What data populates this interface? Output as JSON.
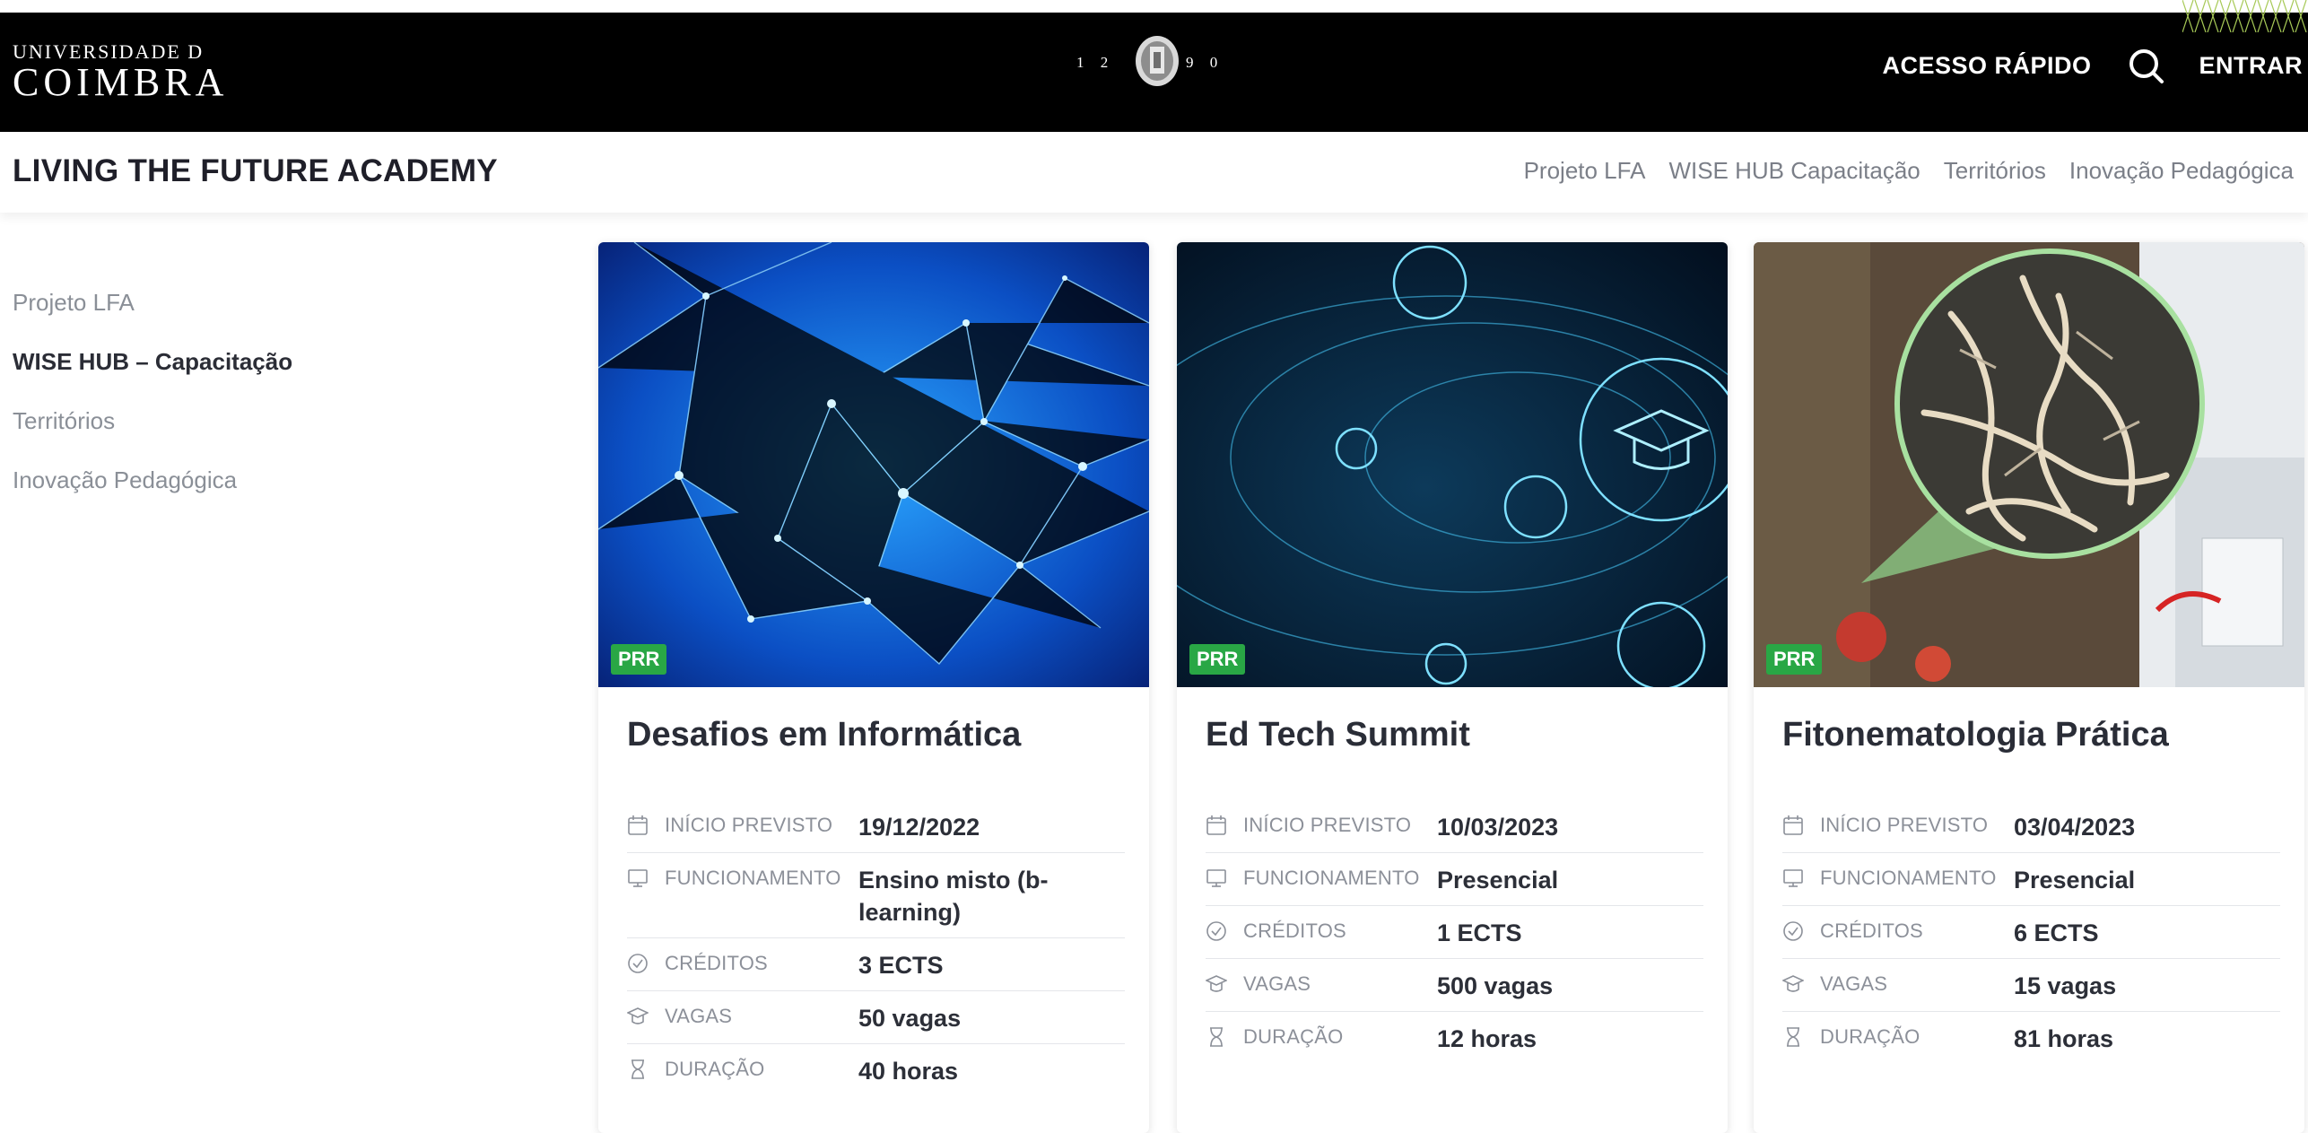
{
  "header": {
    "logo_small": "UNIVERSIDADE D",
    "logo_big": "COIMBRA",
    "year_left": "1 2",
    "year_right": "9 0",
    "quick_access": "ACESSO RÁPIDO",
    "login": "ENTRAR"
  },
  "subheader": {
    "title": "LIVING THE FUTURE ACADEMY",
    "nav": [
      "Projeto LFA",
      "WISE HUB Capacitação",
      "Territórios",
      "Inovação Pedagógica"
    ]
  },
  "sidebar": {
    "items": [
      "Projeto LFA",
      "WISE HUB – Capacitação",
      "Territórios",
      "Inovação Pedagógica"
    ]
  },
  "cards": [
    {
      "badge": "PRR",
      "title": "Desafios em Informática",
      "rows": [
        {
          "label": "INÍCIO PREVISTO",
          "value": "19/12/2022"
        },
        {
          "label": "FUNCIONAMENTO",
          "value": "Ensino misto (b-learning)"
        },
        {
          "label": "CRÉDITOS",
          "value": "3 ECTS"
        },
        {
          "label": "VAGAS",
          "value": "50 vagas"
        },
        {
          "label": "DURAÇÃO",
          "value": "40 horas"
        }
      ]
    },
    {
      "badge": "PRR",
      "title": "Ed Tech Summit",
      "rows": [
        {
          "label": "INÍCIO PREVISTO",
          "value": "10/03/2023"
        },
        {
          "label": "FUNCIONAMENTO",
          "value": "Presencial"
        },
        {
          "label": "CRÉDITOS",
          "value": "1 ECTS"
        },
        {
          "label": "VAGAS",
          "value": "500 vagas"
        },
        {
          "label": "DURAÇÃO",
          "value": "12 horas"
        }
      ]
    },
    {
      "badge": "PRR",
      "title": "Fitonematologia Prática",
      "rows": [
        {
          "label": "INÍCIO PREVISTO",
          "value": "03/04/2023"
        },
        {
          "label": "FUNCIONAMENTO",
          "value": "Presencial"
        },
        {
          "label": "CRÉDITOS",
          "value": "6 ECTS"
        },
        {
          "label": "VAGAS",
          "value": "15 vagas"
        },
        {
          "label": "DURAÇÃO",
          "value": "81 horas"
        }
      ]
    }
  ],
  "colors": {
    "topbar": "#000000",
    "badge": "#29a745",
    "text_dark": "#2a2d37",
    "text_muted": "#8c9099"
  }
}
